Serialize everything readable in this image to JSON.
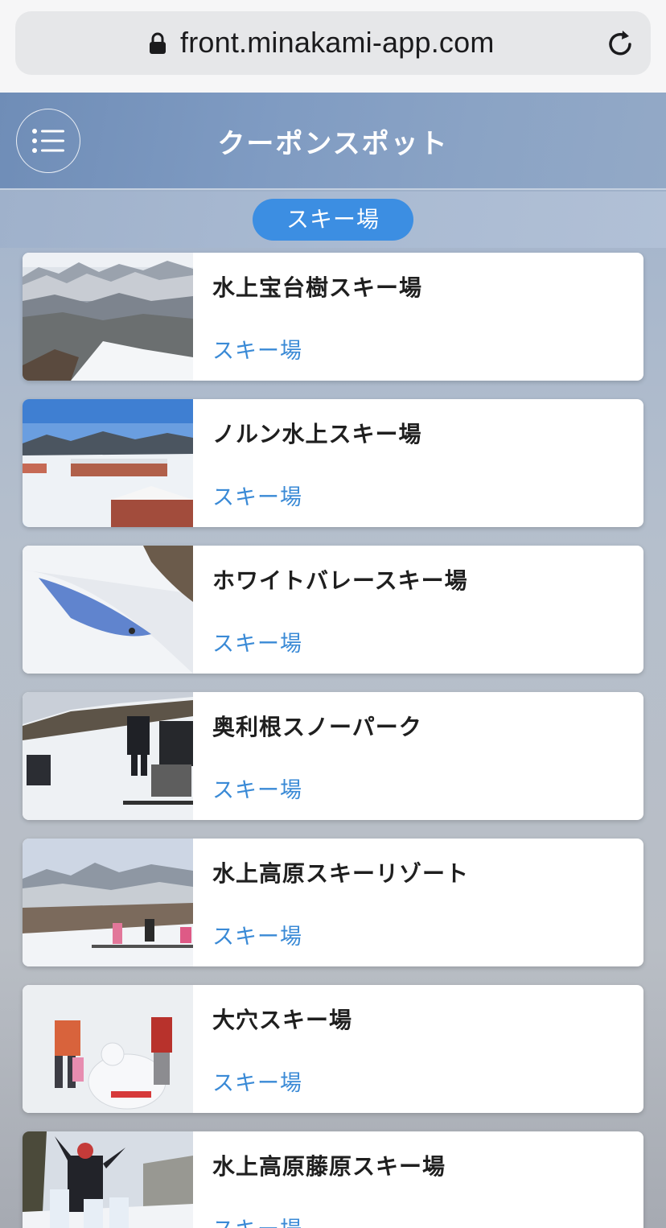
{
  "browser": {
    "url": "front.minakami-app.com"
  },
  "header": {
    "title": "クーポンスポット"
  },
  "category_filter": {
    "selected": "スキー場"
  },
  "spots": [
    {
      "name": "水上宝台樹スキー場",
      "category": "スキー場"
    },
    {
      "name": "ノルン水上スキー場",
      "category": "スキー場"
    },
    {
      "name": "ホワイトバレースキー場",
      "category": "スキー場"
    },
    {
      "name": "奥利根スノーパーク",
      "category": "スキー場"
    },
    {
      "name": "水上高原スキーリゾート",
      "category": "スキー場"
    },
    {
      "name": "大穴スキー場",
      "category": "スキー場"
    },
    {
      "name": "水上高原藤原スキー場",
      "category": "スキー場"
    }
  ]
}
